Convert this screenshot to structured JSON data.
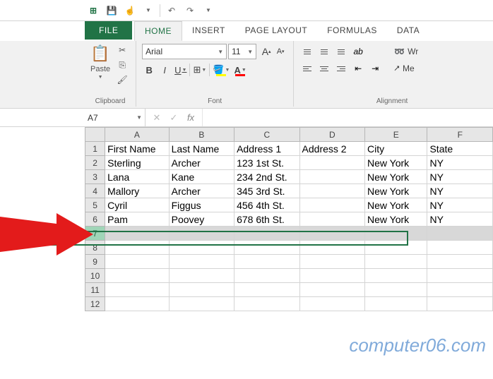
{
  "qat": {
    "excel": "X",
    "save": "💾",
    "touch": "👆",
    "undo": "↶",
    "redo": "↷"
  },
  "tabs": {
    "file": "FILE",
    "home": "HOME",
    "insert": "INSERT",
    "pagelayout": "PAGE LAYOUT",
    "formulas": "FORMULAS",
    "data": "DATA"
  },
  "ribbon": {
    "clipboard": {
      "label": "Clipboard",
      "paste": "Paste"
    },
    "font": {
      "label": "Font",
      "family": "Arial",
      "size": "11",
      "bold": "B",
      "italic": "I",
      "underline": "U",
      "incA": "A",
      "decA": "A"
    },
    "alignment": {
      "label": "Alignment",
      "wrap": "Wr",
      "merge": "Me"
    }
  },
  "namebox": "A7",
  "fx": "fx",
  "columns": [
    "A",
    "B",
    "C",
    "D",
    "E",
    "F"
  ],
  "rows": [
    "1",
    "2",
    "3",
    "4",
    "5",
    "6",
    "7",
    "8",
    "9",
    "10",
    "11",
    "12"
  ],
  "cells": {
    "r1": [
      "First Name",
      "Last Name",
      "Address 1",
      "Address 2",
      "City",
      "State"
    ],
    "r2": [
      "Sterling",
      "Archer",
      "123 1st St.",
      "",
      "New York",
      "NY"
    ],
    "r3": [
      "Lana",
      "Kane",
      "234 2nd St.",
      "",
      "New York",
      "NY"
    ],
    "r4": [
      "Mallory",
      "Archer",
      "345 3rd St.",
      "",
      "New York",
      "NY"
    ],
    "r5": [
      "Cyril",
      "Figgus",
      "456 4th St.",
      "",
      "New York",
      "NY"
    ],
    "r6": [
      "Pam",
      "Poovey",
      "678 6th St.",
      "",
      "New York",
      "NY"
    ]
  },
  "selected_row": 7,
  "watermark": "computer06.com"
}
